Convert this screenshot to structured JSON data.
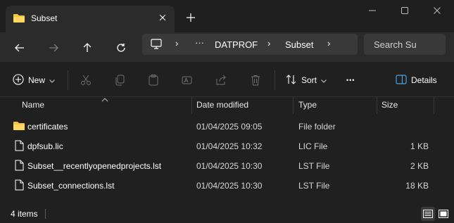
{
  "tab": {
    "title": "Subset"
  },
  "address": {
    "sep_left": "›",
    "ellipsis": "···",
    "crumbs": [
      "DATPROF",
      "Subset"
    ]
  },
  "search": {
    "placeholder": "Search Subset"
  },
  "toolbar": {
    "new_label": "New",
    "sort_label": "Sort",
    "more_label": "•••",
    "details_label": "Details"
  },
  "columns": {
    "name": "Name",
    "date": "Date modified",
    "type": "Type",
    "size": "Size"
  },
  "files": [
    {
      "name": "certificates",
      "date": "01/04/2025 09:05",
      "type": "File folder",
      "size": "",
      "icon": "folder-icon"
    },
    {
      "name": "dpfsub.lic",
      "date": "01/04/2025 10:32",
      "type": "LIC File",
      "size": "1 KB",
      "icon": "file-icon"
    },
    {
      "name": "Subset__recentlyopenedprojects.lst",
      "date": "01/04/2025 10:30",
      "type": "LST File",
      "size": "2 KB",
      "icon": "file-icon"
    },
    {
      "name": "Subset_connections.lst",
      "date": "01/04/2025 10:30",
      "type": "LST File",
      "size": "18 KB",
      "icon": "file-icon"
    }
  ],
  "status": {
    "count": "4 items"
  },
  "colors": {
    "folder": "#f4c542",
    "accent": "#4ca0e0",
    "background": "#202020"
  }
}
